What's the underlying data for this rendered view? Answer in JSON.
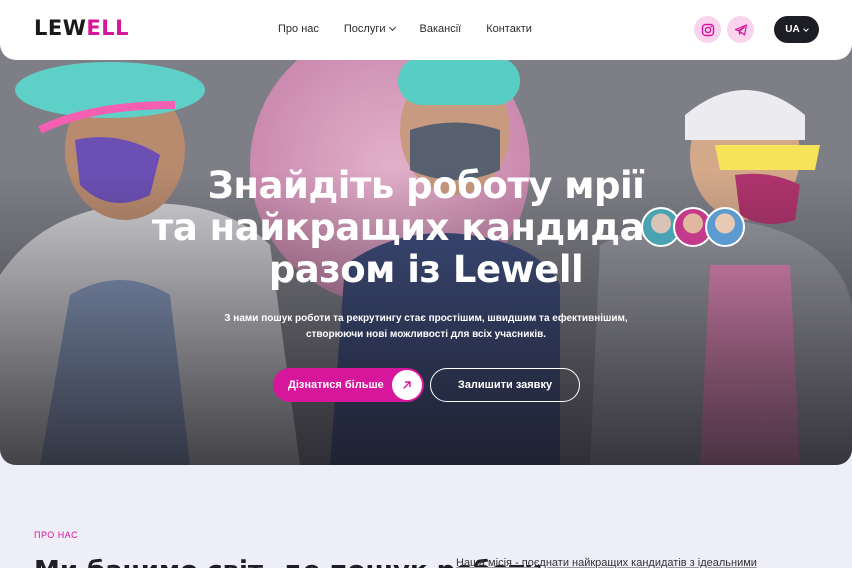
{
  "header": {
    "logo": {
      "part1": "LEW",
      "part2": "ELL"
    },
    "nav": [
      {
        "label": "Про нас"
      },
      {
        "label": "Послуги"
      },
      {
        "label": "Вакансії"
      },
      {
        "label": "Контакти"
      }
    ],
    "social": [
      "instagram-icon",
      "telegram-icon"
    ],
    "language": "UA"
  },
  "hero": {
    "title_line1": "Знайдіть роботу мрії",
    "title_line2": "та найкращих кандидатів",
    "title_line3": "разом із Lewell",
    "subtitle_line1": "З нами пошук роботи та рекрутингу стає простішим, швидшим та ефективнішим,",
    "subtitle_line2": "створюючи нові можливості для всіх учасників.",
    "primary_button": "Дізнатися більше",
    "secondary_button": "Залишити заявку"
  },
  "about": {
    "label": "ПРО НАС",
    "heading": "Ми бачимо світ, де пошук роботи",
    "text": "Наша місія - поєднати найкращих кандидатів з ідеальними"
  },
  "colors": {
    "accent": "#d6169b",
    "dark": "#1d1d24",
    "section_bg": "#eeeef8"
  }
}
